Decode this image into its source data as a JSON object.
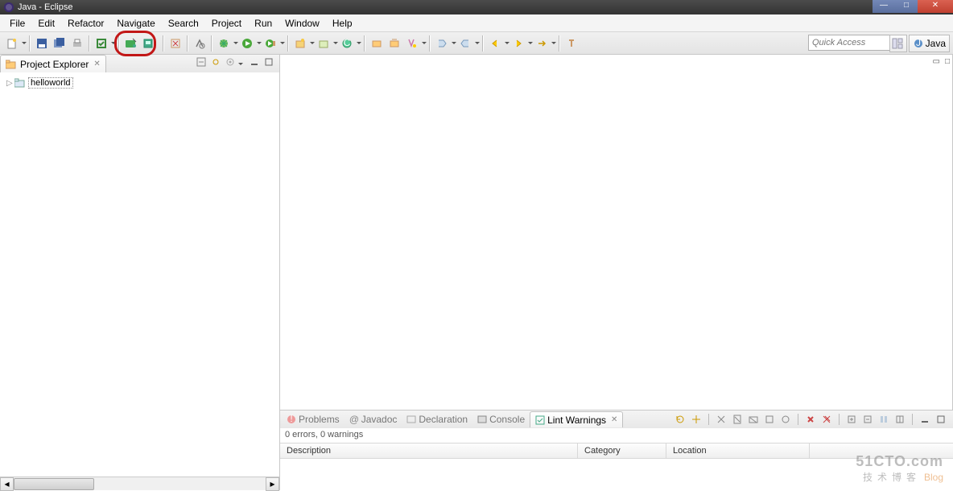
{
  "window": {
    "title": "Java - Eclipse"
  },
  "menu": {
    "items": [
      "File",
      "Edit",
      "Refactor",
      "Navigate",
      "Search",
      "Project",
      "Run",
      "Window",
      "Help"
    ]
  },
  "toolbar": {
    "quick_access_placeholder": "Quick Access",
    "perspective_label": "Java"
  },
  "sidebar": {
    "view_title": "Project Explorer",
    "tree": [
      {
        "label": "helloworld"
      }
    ]
  },
  "bottom": {
    "tabs": [
      {
        "label": "Problems",
        "active": false
      },
      {
        "label": "Javadoc",
        "active": false
      },
      {
        "label": "Declaration",
        "active": false
      },
      {
        "label": "Console",
        "active": false
      },
      {
        "label": "Lint Warnings",
        "active": true
      }
    ],
    "status": "0 errors, 0 warnings",
    "columns": [
      "Description",
      "Category",
      "Location"
    ]
  },
  "watermark": {
    "line1": "51CTO.com",
    "line2": "技术博客",
    "line2_suffix": "Blog"
  }
}
